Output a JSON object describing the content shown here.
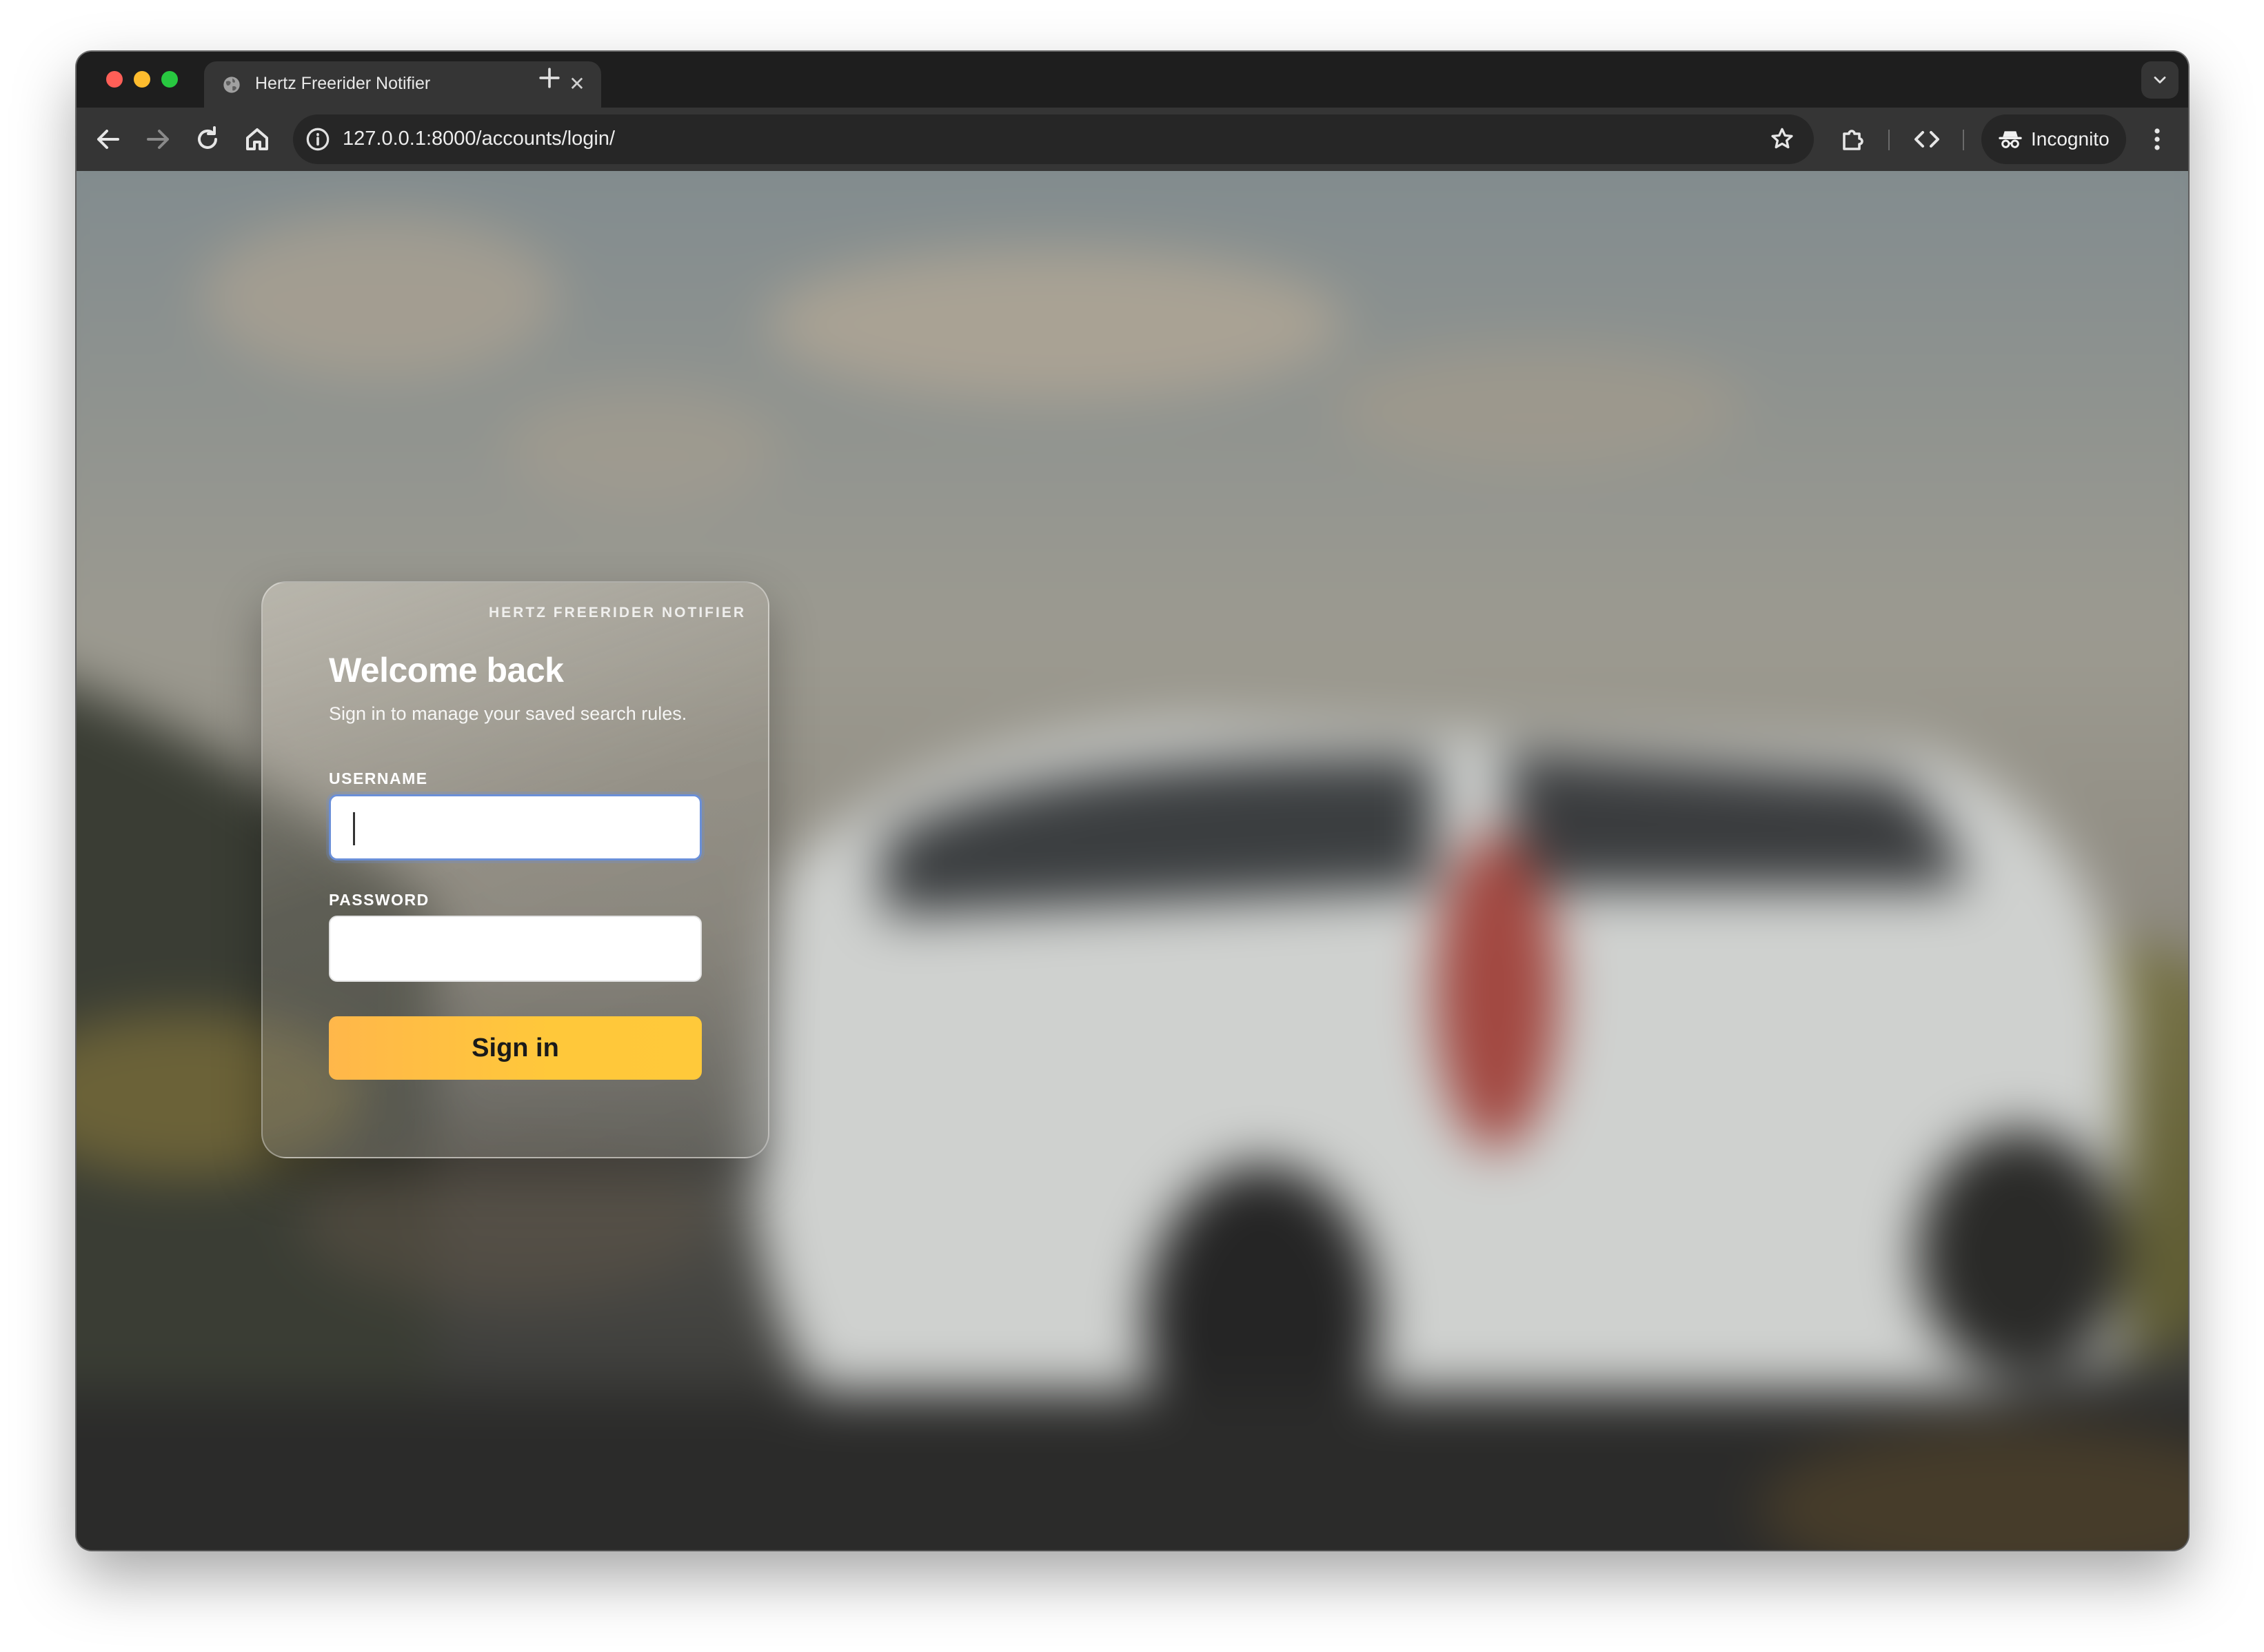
{
  "browser": {
    "tab": {
      "title": "Hertz Freerider Notifier",
      "favicon_icon": "globe-icon",
      "close_glyph": "✕"
    },
    "address_bar": {
      "url": "127.0.0.1:8000/accounts/login/",
      "info_icon": "info-icon",
      "bookmark_icon": "star-icon"
    },
    "toolbar_icons": [
      "back-arrow-icon",
      "forward-arrow-icon",
      "reload-icon",
      "home-icon",
      "extensions-icon",
      "devtools-icon",
      "more-menu-icon"
    ],
    "profile": {
      "label": "Incognito",
      "icon": "incognito-icon"
    }
  },
  "login": {
    "brand": "HERTZ FREERIDER NOTIFIER",
    "title": "Welcome back",
    "subtitle": "Sign in to manage your saved search rules.",
    "username": {
      "label": "USERNAME",
      "value": "",
      "focused": true
    },
    "password": {
      "label": "PASSWORD",
      "value": ""
    },
    "submit_label": "Sign in"
  },
  "colors": {
    "accent_button": "#ffc23f",
    "focus_ring": "#6a8fd8",
    "chrome_dark": "#1e1e1e",
    "chrome_toolbar": "#353535"
  }
}
